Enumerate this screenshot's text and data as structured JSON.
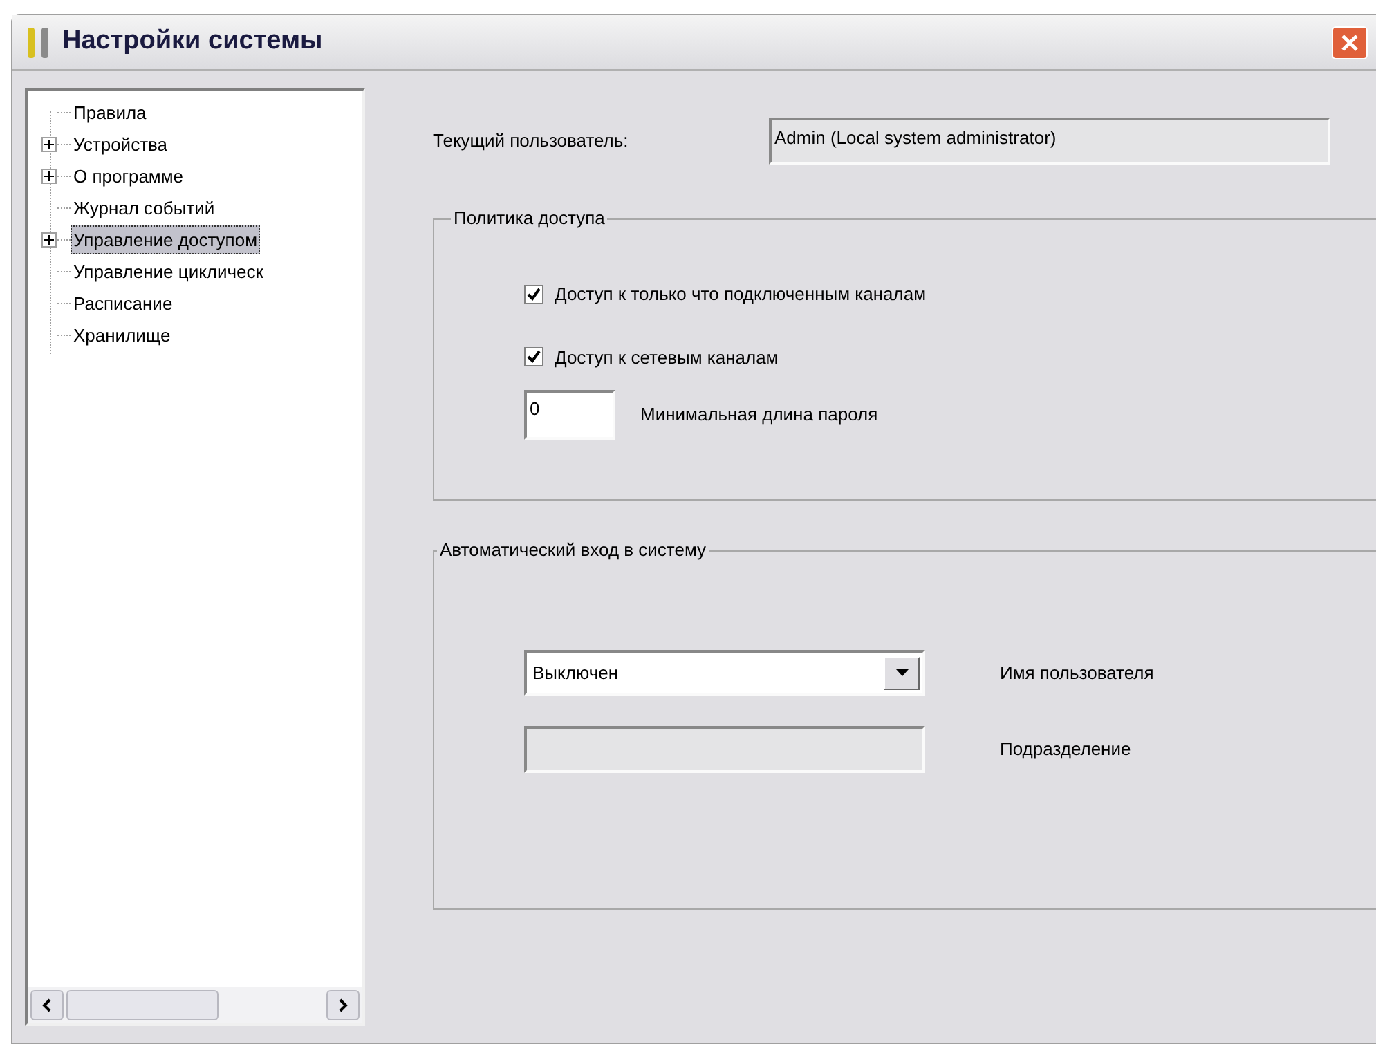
{
  "window": {
    "title": "Настройки системы"
  },
  "tree": {
    "items": [
      {
        "label": "Правила",
        "kind": "leaf",
        "selected": false
      },
      {
        "label": "Устройства",
        "kind": "node",
        "selected": false
      },
      {
        "label": "О программе",
        "kind": "node",
        "selected": false
      },
      {
        "label": "Журнал событий",
        "kind": "leaf",
        "selected": false
      },
      {
        "label": "Управление доступом",
        "kind": "node",
        "selected": true
      },
      {
        "label": "Управление циклическ",
        "kind": "leaf",
        "selected": false
      },
      {
        "label": "Расписание",
        "kind": "leaf",
        "selected": false
      },
      {
        "label": "Хранилище",
        "kind": "leaf",
        "selected": false
      }
    ]
  },
  "current_user": {
    "label": "Текущий пользователь:",
    "value": "Admin (Local system administrator)"
  },
  "access_policy": {
    "title": "Политика доступа",
    "checkboxes": [
      {
        "label": "Доступ к только что подключенным каналам",
        "checked": true
      },
      {
        "label": "Доступ к сетевым каналам",
        "checked": true
      }
    ],
    "min_password": {
      "value": "0",
      "label": "Минимальная длина пароля"
    }
  },
  "auto_login": {
    "title": "Автоматический вход в систему",
    "user_select": {
      "value": "Выключен",
      "label": "Имя пользователя"
    },
    "department": {
      "label": "Подразделение",
      "disabled": true
    }
  }
}
